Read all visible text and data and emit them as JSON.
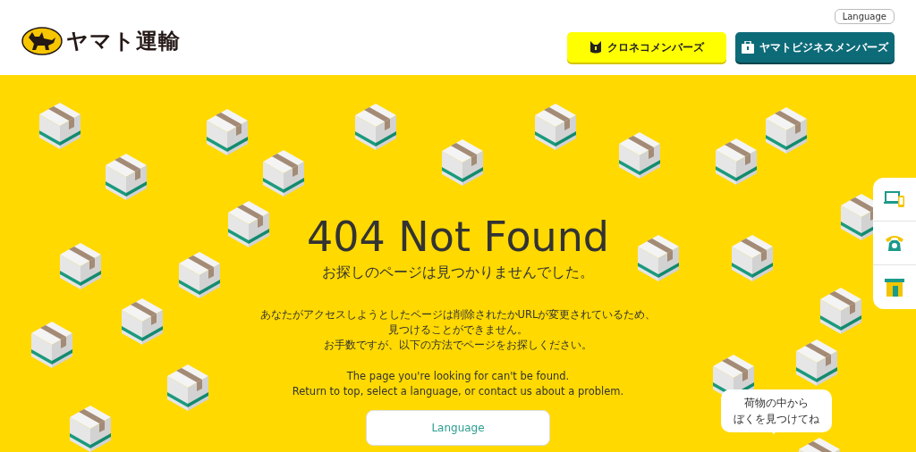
{
  "header": {
    "logo_text": "ヤマト運輸",
    "language_button": "Language",
    "member_buttons": [
      {
        "label": "クロネコメンバーズ",
        "kind": "personal"
      },
      {
        "label": "ヤマトビジネスメンバーズ",
        "kind": "business"
      }
    ]
  },
  "main": {
    "title": "404 Not Found",
    "subtitle": "お探しのページは見つかりませんでした。",
    "message_ja": [
      "あなたがアクセスしようとしたページは削除されたかURLが変更されているため、",
      "見つけることができません。",
      "お手数ですが、以下の方法でページをお探しください。"
    ],
    "message_en": [
      "The page you're looking for can't be found.",
      "Return to top, select a language, or contact us about a problem."
    ],
    "language_button": "Language"
  },
  "side_menu": [
    {
      "kind": "online"
    },
    {
      "kind": "phone"
    },
    {
      "kind": "store"
    }
  ],
  "speech_bubble": [
    "荷物の中から",
    "ぼくを見つけてね"
  ]
}
